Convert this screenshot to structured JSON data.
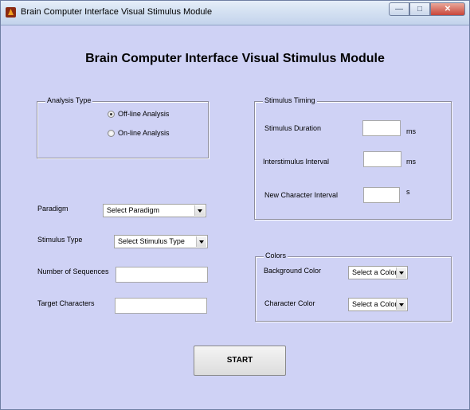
{
  "window": {
    "title": "Brain Computer Interface Visual Stimulus Module"
  },
  "header": {
    "title": "Brain Computer Interface Visual Stimulus Module"
  },
  "analysis_type": {
    "legend": "Analysis Type",
    "options": [
      {
        "label": "Off-line Analysis",
        "selected": true
      },
      {
        "label": "On-line Analysis",
        "selected": false
      }
    ]
  },
  "stimulus_timing": {
    "legend": "Stimulus Timing",
    "rows": [
      {
        "label": "Stimulus Duration",
        "value": "",
        "unit": "ms"
      },
      {
        "label": "Interstimulus Interval",
        "value": "",
        "unit": "ms"
      },
      {
        "label": "New Character Interval",
        "value": "",
        "unit": "s"
      }
    ]
  },
  "form": {
    "paradigm": {
      "label": "Paradigm",
      "value": "Select Paradigm"
    },
    "stimulus_type": {
      "label": "Stimulus Type",
      "value": "Select Stimulus Type"
    },
    "num_sequences": {
      "label": "Number of Sequences",
      "value": ""
    },
    "target_characters": {
      "label": "Target Characters",
      "value": ""
    }
  },
  "colors": {
    "legend": "Colors",
    "background": {
      "label": "Background Color",
      "value": "Select a Color"
    },
    "character": {
      "label": "Character Color",
      "value": "Select a Color"
    }
  },
  "start_button": {
    "label": "START"
  },
  "theme": {
    "panel_bg": "#cfd2f5"
  }
}
